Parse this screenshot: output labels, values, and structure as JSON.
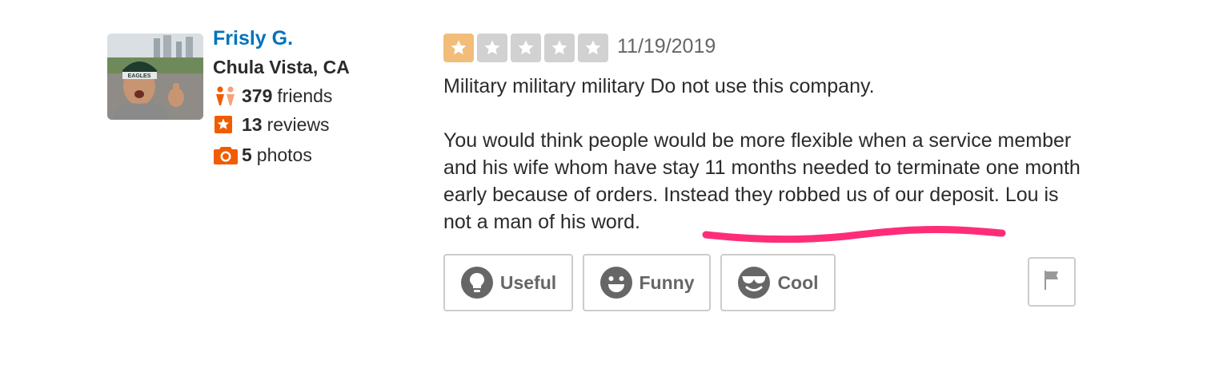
{
  "user": {
    "name": "Frisly G.",
    "location": "Chula Vista, CA",
    "friends_count": "379",
    "friends_label": "friends",
    "reviews_count": "13",
    "reviews_label": "reviews",
    "photos_count": "5",
    "photos_label": "photos",
    "avatar_cap_text": "EAGLES"
  },
  "review": {
    "rating": 1,
    "max_rating": 5,
    "date": "11/19/2019",
    "paragraph1": "Military military military Do not use this company.",
    "paragraph2_start": "You would think people would be more flexible when a service member and his wife whom have stay 11 months needed to terminate one month early because of orders. Instead they robbed us of our deposit. ",
    "paragraph2_highlight": "Lou is not a man of his word."
  },
  "votes": {
    "useful_label": "Useful",
    "funny_label": "Funny",
    "cool_label": "Cool"
  },
  "colors": {
    "name_link": "#0073bb",
    "star_on": "#f2bd79",
    "star_off": "#d1d1d1",
    "stat_icon": "#f15c00",
    "highlight_stroke": "#ff2d78",
    "button_text": "#666666"
  },
  "icons": {
    "friends": "friends-icon",
    "reviews": "star-badge-icon",
    "photos": "camera-icon",
    "useful": "lightbulb-icon",
    "funny": "smiley-icon",
    "cool": "sunglasses-icon",
    "flag": "flag-icon"
  }
}
